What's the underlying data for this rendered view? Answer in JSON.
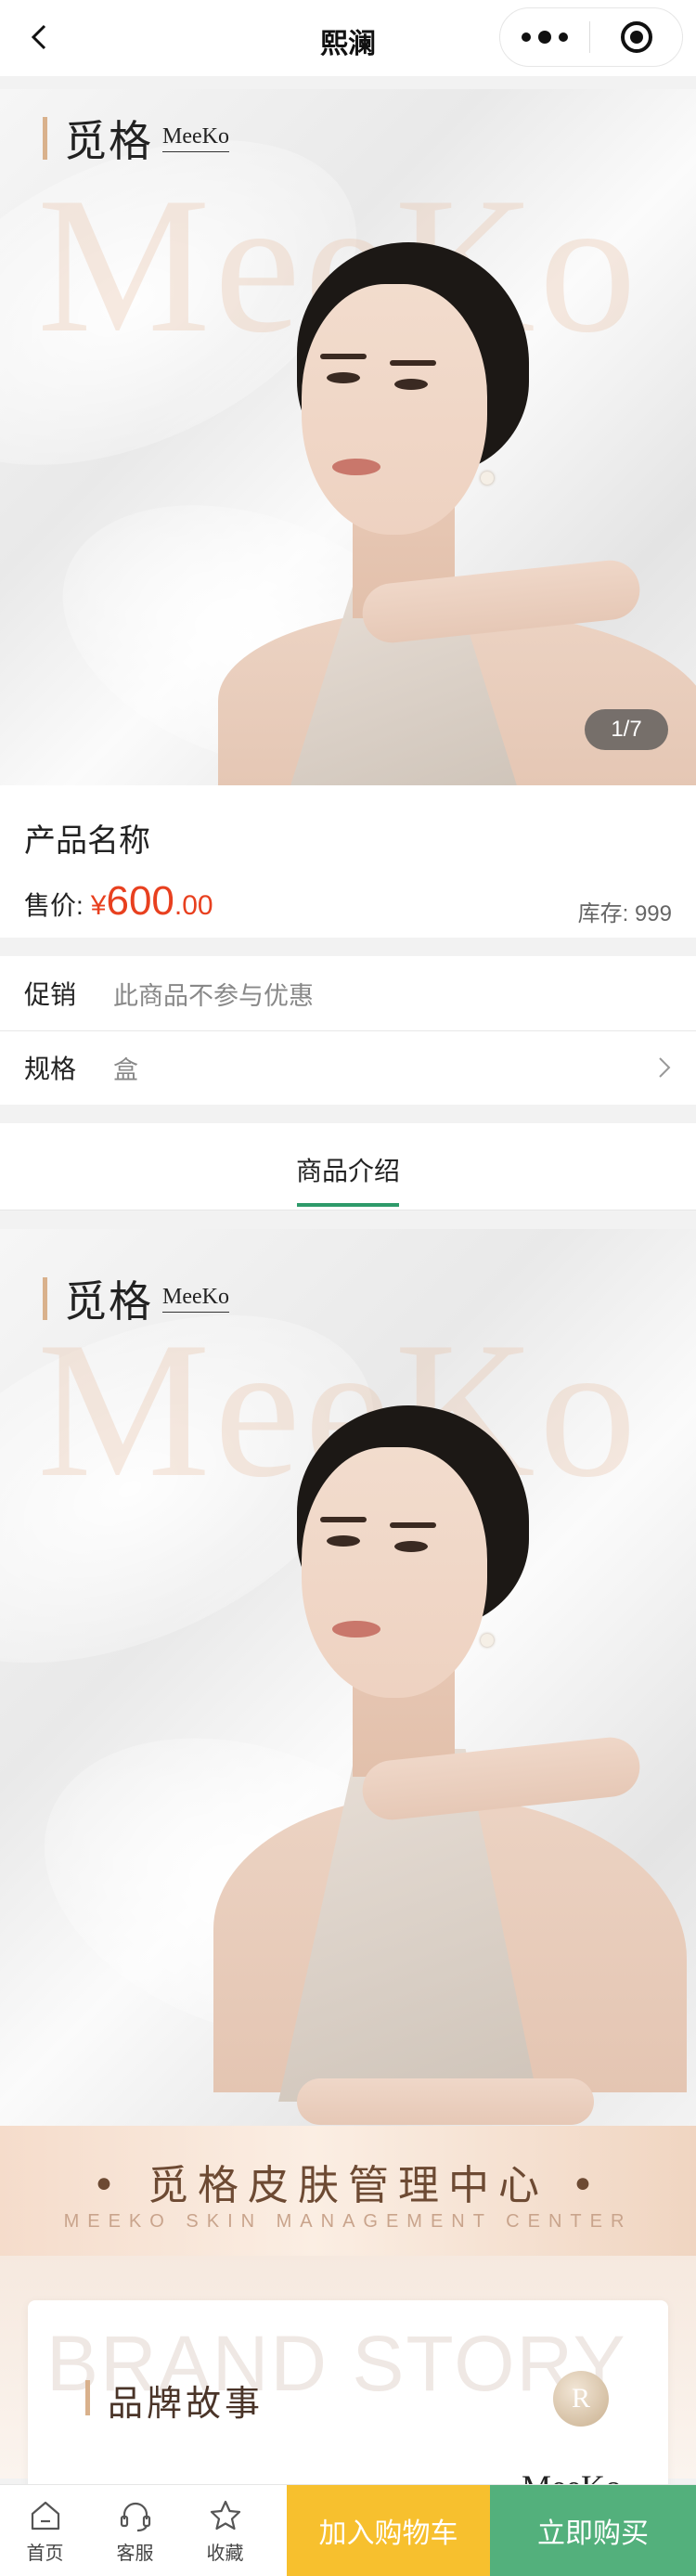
{
  "nav": {
    "title": "熙澜",
    "back_icon": "chevron-left-icon",
    "more_icon": "more-dots-icon",
    "close_icon": "target-close-icon"
  },
  "hero": {
    "brand_cn": "觅格",
    "brand_en": "MeeKo",
    "watermark": "MeeKo",
    "counter": "1/7"
  },
  "product": {
    "name": "产品名称",
    "price_label": "售价:",
    "currency": "¥",
    "price_int": "600",
    "price_dec": ".00",
    "stock": "库存: 999",
    "price_color": "#e8401f"
  },
  "promo": {
    "label": "促销",
    "value": "此商品不参与优惠"
  },
  "spec": {
    "label": "规格",
    "value": "盒"
  },
  "detail_tab": {
    "label": "商品介绍",
    "accent": "#2e9a6a"
  },
  "detail_poster": {
    "brand_cn": "觅格",
    "brand_en": "MeeKo",
    "watermark": "MeeKo",
    "banner_cn": "• 觅格皮肤管理中心 •",
    "banner_en": "MEEKO SKIN MANAGEMENT CENTER",
    "story_watermark": "BRAND STORY",
    "story_title": "品牌故事",
    "story_logo": "R",
    "story_brand_en": "MeeKo"
  },
  "bottom_bar": {
    "home": "首页",
    "service": "客服",
    "favorite": "收藏",
    "add_cart": "加入购物车",
    "buy_now": "立即购买",
    "cart_color": "#f7c02e",
    "buy_color": "#53b07c"
  }
}
